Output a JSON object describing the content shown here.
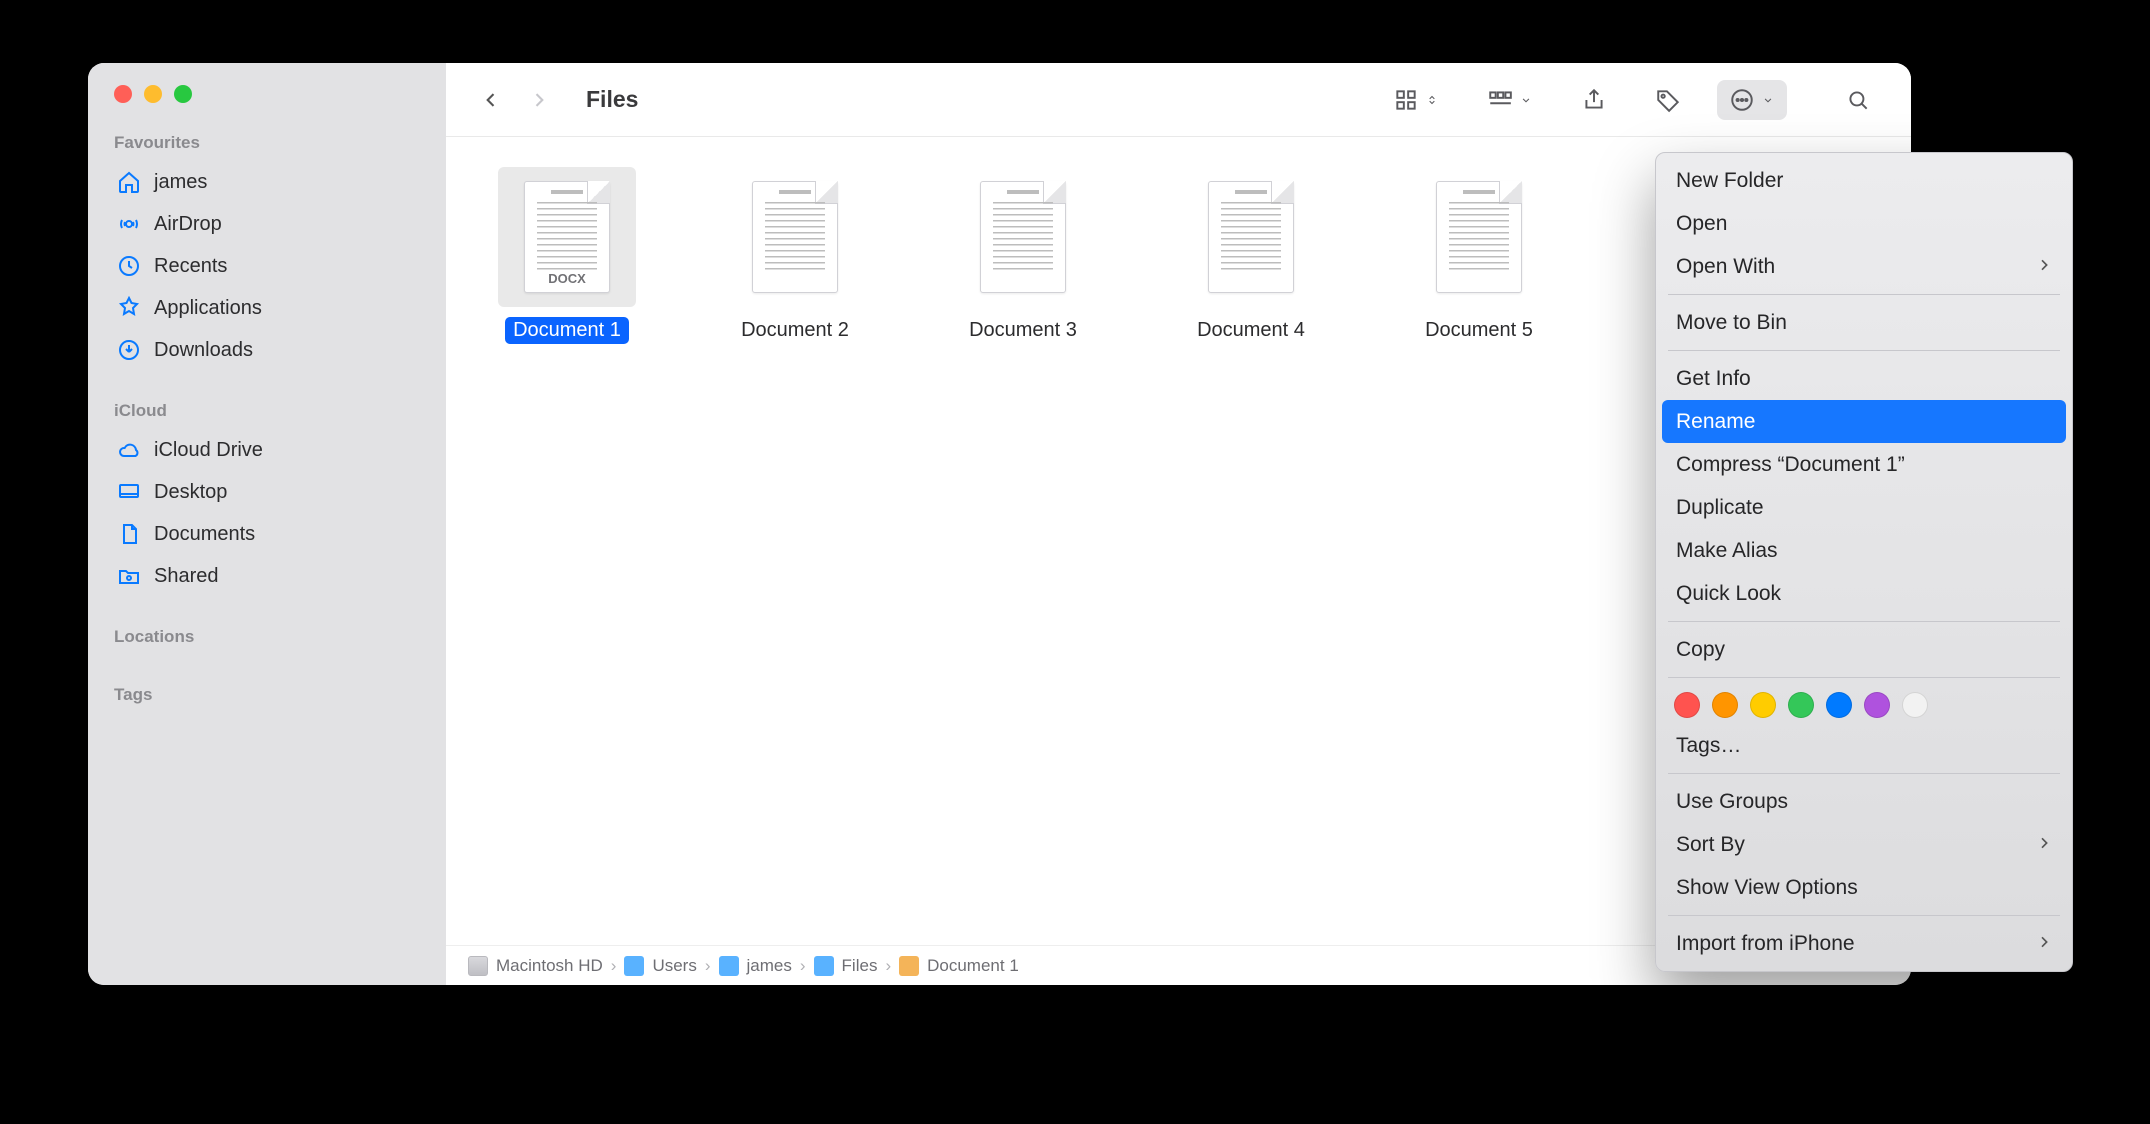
{
  "window_title": "Files",
  "sidebar": {
    "sections": [
      {
        "heading": "Favourites",
        "items": [
          {
            "label": "james"
          },
          {
            "label": "AirDrop"
          },
          {
            "label": "Recents"
          },
          {
            "label": "Applications"
          },
          {
            "label": "Downloads"
          }
        ]
      },
      {
        "heading": "iCloud",
        "items": [
          {
            "label": "iCloud Drive"
          },
          {
            "label": "Desktop"
          },
          {
            "label": "Documents"
          },
          {
            "label": "Shared"
          }
        ]
      },
      {
        "heading": "Locations",
        "items": []
      },
      {
        "heading": "Tags",
        "items": []
      }
    ]
  },
  "files": [
    {
      "label": "Document 1",
      "badge": "DOCX",
      "selected": true
    },
    {
      "label": "Document 2",
      "selected": false
    },
    {
      "label": "Document 3",
      "selected": false
    },
    {
      "label": "Document 4",
      "selected": false
    },
    {
      "label": "Document 5",
      "selected": false
    }
  ],
  "path": [
    {
      "label": "Macintosh HD",
      "icon": "disk"
    },
    {
      "label": "Users",
      "icon": "folder"
    },
    {
      "label": "james",
      "icon": "folder"
    },
    {
      "label": "Files",
      "icon": "folder"
    },
    {
      "label": "Document 1",
      "icon": "doc"
    }
  ],
  "context_menu": {
    "groups": [
      [
        {
          "label": "New Folder"
        },
        {
          "label": "Open"
        },
        {
          "label": "Open With",
          "submenu": true
        }
      ],
      [
        {
          "label": "Move to Bin"
        }
      ],
      [
        {
          "label": "Get Info"
        },
        {
          "label": "Rename",
          "highlight": true
        },
        {
          "label": "Compress “Document 1”"
        },
        {
          "label": "Duplicate"
        },
        {
          "label": "Make Alias"
        },
        {
          "label": "Quick Look"
        }
      ],
      [
        {
          "label": "Copy"
        }
      ],
      "TAGS_ROW",
      [
        {
          "label": "Tags…"
        }
      ],
      [
        {
          "label": "Use Groups"
        },
        {
          "label": "Sort By",
          "submenu": true
        },
        {
          "label": "Show View Options"
        }
      ],
      [
        {
          "label": "Import from iPhone",
          "submenu": true
        }
      ]
    ],
    "tag_colors": [
      "red",
      "orange",
      "yellow",
      "green",
      "blue",
      "purple",
      "none"
    ]
  }
}
